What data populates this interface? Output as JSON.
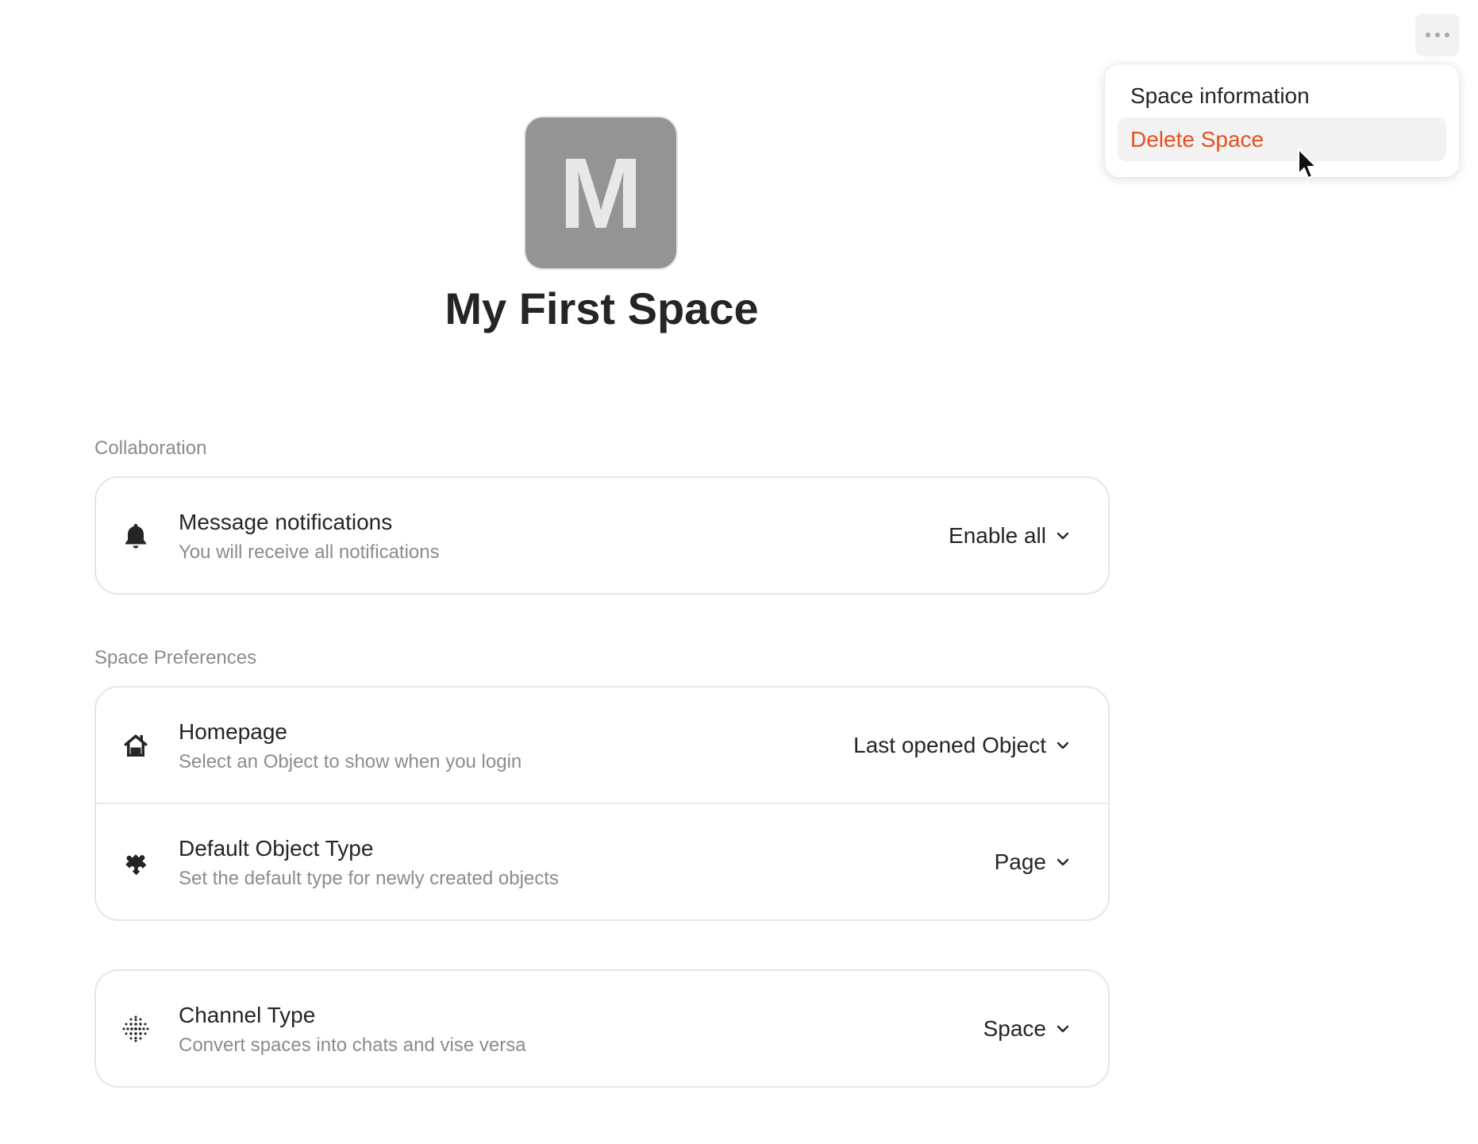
{
  "menu": {
    "items": [
      {
        "label": "Space information"
      },
      {
        "label": "Delete Space"
      }
    ]
  },
  "space": {
    "icon_letter": "M",
    "title": "My First Space"
  },
  "sections": {
    "collaboration": {
      "label": "Collaboration",
      "rows": [
        {
          "icon": "bell-icon",
          "title": "Message notifications",
          "subtitle": "You will receive all notifications",
          "value": "Enable all"
        }
      ]
    },
    "preferences": {
      "label": "Space Preferences",
      "rows": [
        {
          "icon": "home-icon",
          "title": "Homepage",
          "subtitle": "Select an Object to show when you login",
          "value": "Last opened Object"
        },
        {
          "icon": "puzzle-icon",
          "title": "Default Object Type",
          "subtitle": "Set the default type for newly created objects",
          "value": "Page"
        }
      ]
    },
    "channel": {
      "rows": [
        {
          "icon": "dots-grid-icon",
          "title": "Channel Type",
          "subtitle": "Convert spaces into chats and vise versa",
          "value": "Space"
        }
      ]
    }
  },
  "colors": {
    "danger": "#e5501e",
    "avatar_bg": "#949494",
    "muted_text": "#8c8c8c",
    "border": "#e6e6e6"
  }
}
